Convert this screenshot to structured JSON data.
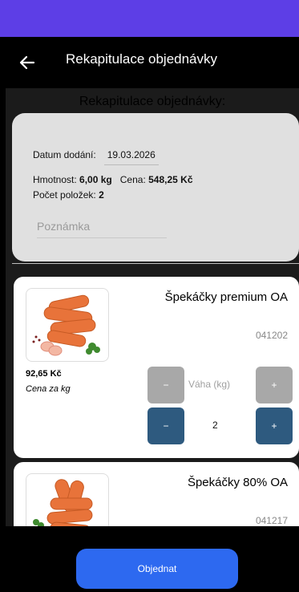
{
  "header": {
    "title": "Rekapitulace objednávky",
    "back_icon": "arrow-left-icon"
  },
  "section_title": "Rekapitulace objednávky:",
  "summary": {
    "date_label": "Datum dodání:",
    "date_value": "19.03.2026",
    "weight_label": "Hmotnost:",
    "weight_value": "6,00 kg",
    "price_label": "Cena:",
    "price_value": "548,25 Kč",
    "count_label": "Počet položek:",
    "count_value": "2",
    "note_placeholder": "Poznámka"
  },
  "products": [
    {
      "name": "Špekáčky premium OA",
      "code": "041202",
      "price": "92,65 Kč",
      "unit": "Cena za kg",
      "weight_label": "Váha (kg)",
      "quantity": "2",
      "minus": "−",
      "plus": "+"
    },
    {
      "name": "Špekáčky 80% OA",
      "code": "041217"
    }
  ],
  "footer": {
    "order_label": "Objednat"
  },
  "colors": {
    "status_bar": "#5d3ee6",
    "accent": "#2d69f0",
    "stepper": "#2e5a7f"
  }
}
